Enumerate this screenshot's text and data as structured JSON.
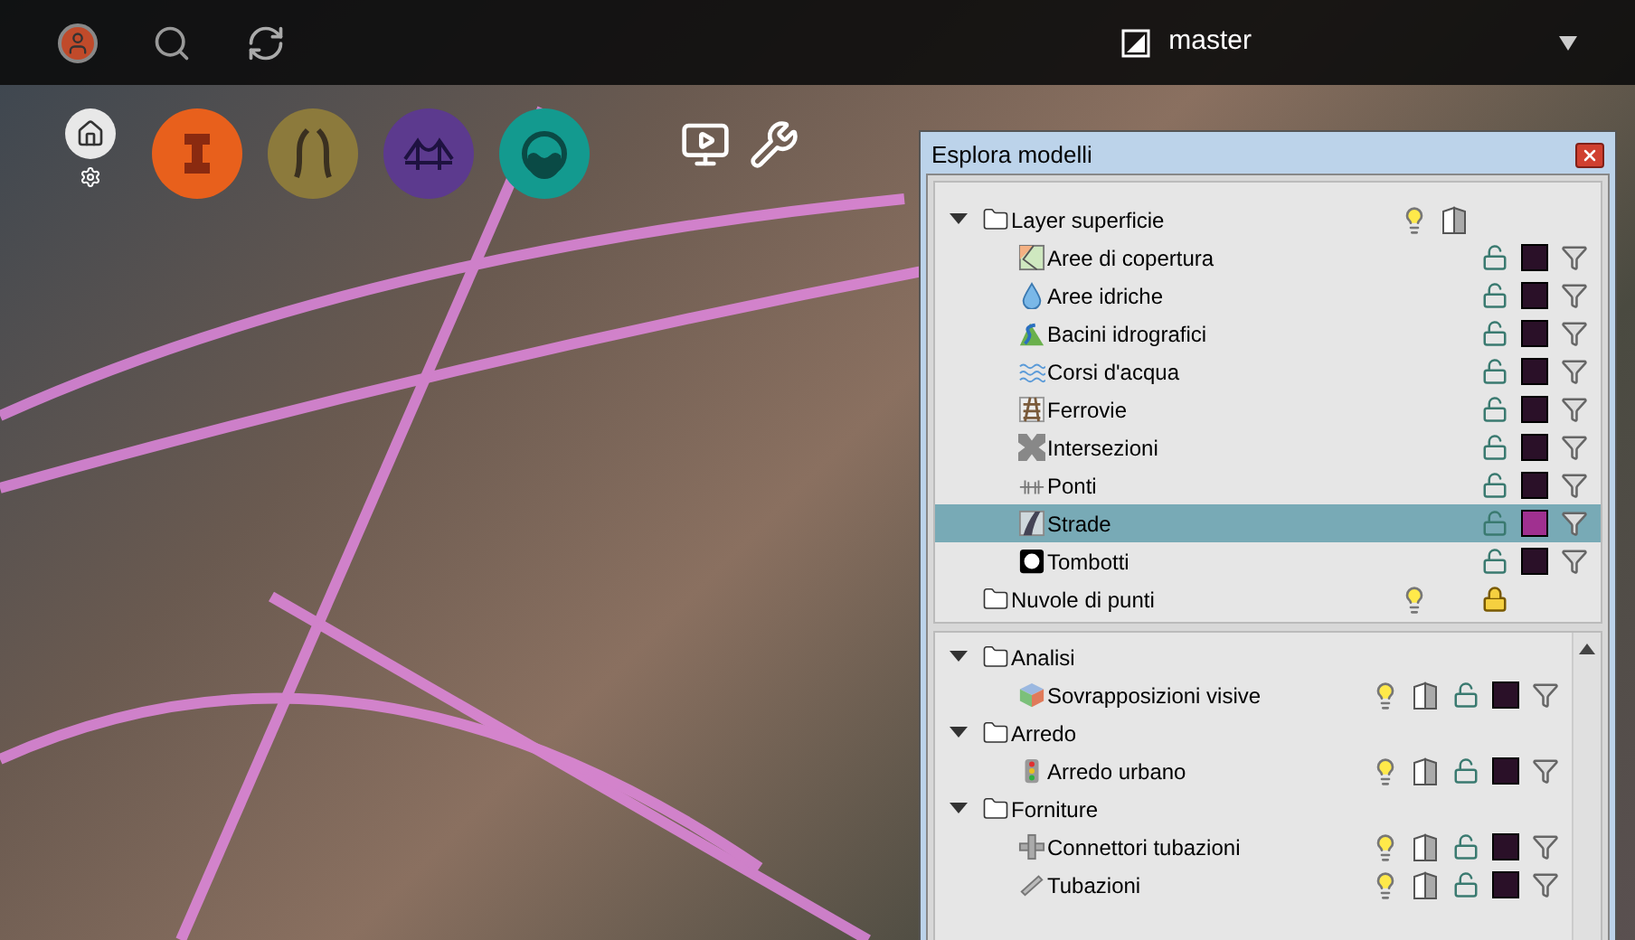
{
  "top_bar": {
    "branch": "master"
  },
  "toolbar": {
    "items": [
      {
        "kind": "home"
      },
      {
        "kind": "orange"
      },
      {
        "kind": "road"
      },
      {
        "kind": "bridge"
      },
      {
        "kind": "water"
      },
      {
        "kind": "presentation"
      },
      {
        "kind": "tools"
      }
    ]
  },
  "panel": {
    "title": "Esplora modelli",
    "upper_tree": [
      {
        "label": "Layer superficie",
        "kind": "folder",
        "expanded": true,
        "selected": false,
        "lightbulb": true,
        "split_view": true,
        "children": [
          {
            "label": "Aree di copertura",
            "kind": "map",
            "selected": false,
            "locked": false,
            "style": true
          },
          {
            "label": "Aree idriche",
            "kind": "drop",
            "selected": false,
            "locked": false,
            "style": true
          },
          {
            "label": "Bacini idrografici",
            "kind": "basin",
            "selected": false,
            "locked": false,
            "style": true
          },
          {
            "label": "Corsi d'acqua",
            "kind": "waves",
            "selected": false,
            "locked": false,
            "style": true
          },
          {
            "label": "Ferrovie",
            "kind": "rail",
            "selected": false,
            "locked": false,
            "style": true
          },
          {
            "label": "Intersezioni",
            "kind": "intersection",
            "selected": false,
            "locked": false,
            "style": true
          },
          {
            "label": "Ponti",
            "kind": "bridge",
            "selected": false,
            "locked": false,
            "style": true
          },
          {
            "label": "Strade",
            "kind": "road",
            "selected": true,
            "locked": false,
            "style": true
          },
          {
            "label": "Tombotti",
            "kind": "manhole",
            "selected": false,
            "locked": false,
            "style": true
          }
        ]
      },
      {
        "label": "Nuvole di punti",
        "kind": "folder",
        "selected": false,
        "lightbulb": true,
        "locked": true
      }
    ],
    "lower_tree": [
      {
        "label": "Analisi",
        "kind": "folder",
        "expanded": true,
        "selected": false,
        "children": [
          {
            "label": "Sovrapposizioni visive",
            "kind": "cube",
            "selected": false,
            "lightbulb": true,
            "split_view": true,
            "locked": false,
            "style": true
          }
        ]
      },
      {
        "label": "Arredo",
        "kind": "folder",
        "expanded": true,
        "selected": false,
        "children": [
          {
            "label": "Arredo urbano",
            "kind": "trafficlight",
            "selected": false,
            "lightbulb": true,
            "split_view": true,
            "locked": false,
            "style": true
          }
        ]
      },
      {
        "label": "Forniture",
        "kind": "folder",
        "expanded": true,
        "selected": false,
        "children": [
          {
            "label": "Connettori tubazioni",
            "kind": "connector",
            "selected": false,
            "lightbulb": true,
            "split_view": true,
            "locked": false,
            "style": true
          },
          {
            "label": "Tubazioni",
            "kind": "pipe",
            "selected": false,
            "lightbulb": true,
            "split_view": true,
            "locked": false,
            "style": true
          }
        ]
      }
    ]
  }
}
